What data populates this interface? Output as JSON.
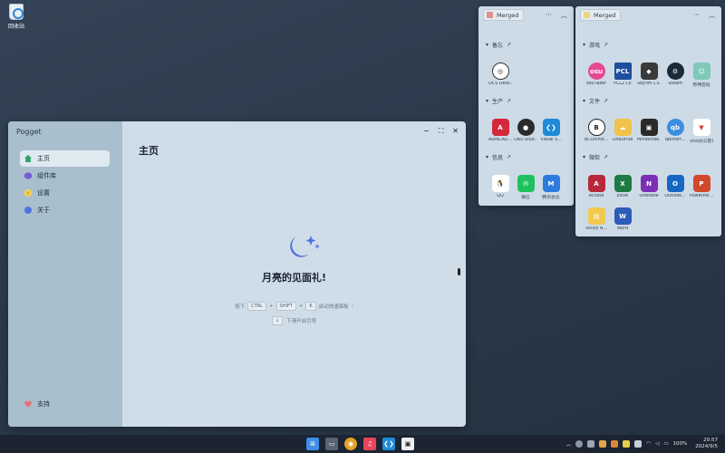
{
  "desktop": {
    "recycle_bin_label": "回收站"
  },
  "window": {
    "title": "Pogget",
    "controls": {
      "minimize": "−",
      "maximize": "⛶",
      "close": "✕"
    },
    "nav": [
      {
        "label": "主页",
        "icon": "home-icon",
        "active": true
      },
      {
        "label": "组件库",
        "icon": "library-icon"
      },
      {
        "label": "设置",
        "icon": "settings-icon"
      },
      {
        "label": "关于",
        "icon": "about-icon"
      }
    ],
    "support_label": "支持",
    "page_title": "主页",
    "welcome_text": "月亮的见面礼!",
    "hint_prefix": "按下",
    "keys": [
      "CTRL",
      "SHIFT",
      "K"
    ],
    "hint_suffix": "启动快速面板",
    "hint_arrow": "›",
    "hint2_key": "↓",
    "hint2_text": "下滑开启引导"
  },
  "panel_left": {
    "tag": "Merged",
    "tag_color": "#e08f8f",
    "sections": [
      {
        "title": "备忘",
        "apps": [
          {
            "label": "OCS Desk...",
            "icon": "ocs-icon"
          }
        ]
      },
      {
        "title": "生产",
        "apps": [
          {
            "label": "AutoCAD...",
            "icon": "autocad-icon"
          },
          {
            "label": "OBS Stud...",
            "icon": "obs-icon"
          },
          {
            "label": "Visual S...",
            "icon": "vscode-icon"
          }
        ]
      },
      {
        "title": "信息",
        "apps": [
          {
            "label": "QQ",
            "icon": "qq-icon"
          },
          {
            "label": "微信",
            "icon": "wechat-icon"
          },
          {
            "label": "腾讯会议",
            "icon": "tencent-meeting-icon"
          }
        ]
      }
    ]
  },
  "panel_right": {
    "tag": "Merged",
    "tag_color": "#ecd77a",
    "sections": [
      {
        "title": "游戏",
        "apps": [
          {
            "label": "osu!lazer",
            "icon": "osu-icon"
          },
          {
            "label": "PCL2 CE",
            "icon": "pcl-icon"
          },
          {
            "label": "Skyrim CS...",
            "icon": "skyrim-icon"
          },
          {
            "label": "Steam",
            "icon": "steam-icon"
          },
          {
            "label": "原神启动",
            "icon": "genshin-icon"
          }
        ]
      },
      {
        "title": "文件",
        "apps": [
          {
            "label": "BCUninst...",
            "icon": "bcuninstaller-icon"
          },
          {
            "label": "OneDrive",
            "icon": "onedrive-icon"
          },
          {
            "label": "MiniBinNe...",
            "icon": "minibin-icon"
          },
          {
            "label": "qBittorr...",
            "icon": "qbittorrent-icon"
          },
          {
            "label": "vivo办公套件",
            "icon": "vivo-icon"
          }
        ]
      },
      {
        "title": "微软",
        "apps": [
          {
            "label": "Access",
            "icon": "access-icon"
          },
          {
            "label": "Excel",
            "icon": "excel-icon"
          },
          {
            "label": "OneNote",
            "icon": "onenote-icon"
          },
          {
            "label": "Outlook...",
            "icon": "outlook-icon"
          },
          {
            "label": "PowerPoi...",
            "icon": "powerpoint-icon"
          },
          {
            "label": "Sticky N...",
            "icon": "sticky-notes-icon"
          },
          {
            "label": "Word",
            "icon": "word-icon"
          }
        ]
      }
    ]
  },
  "taskbar": {
    "battery": "100%",
    "time": "20:57",
    "date": "2024/9/5"
  }
}
